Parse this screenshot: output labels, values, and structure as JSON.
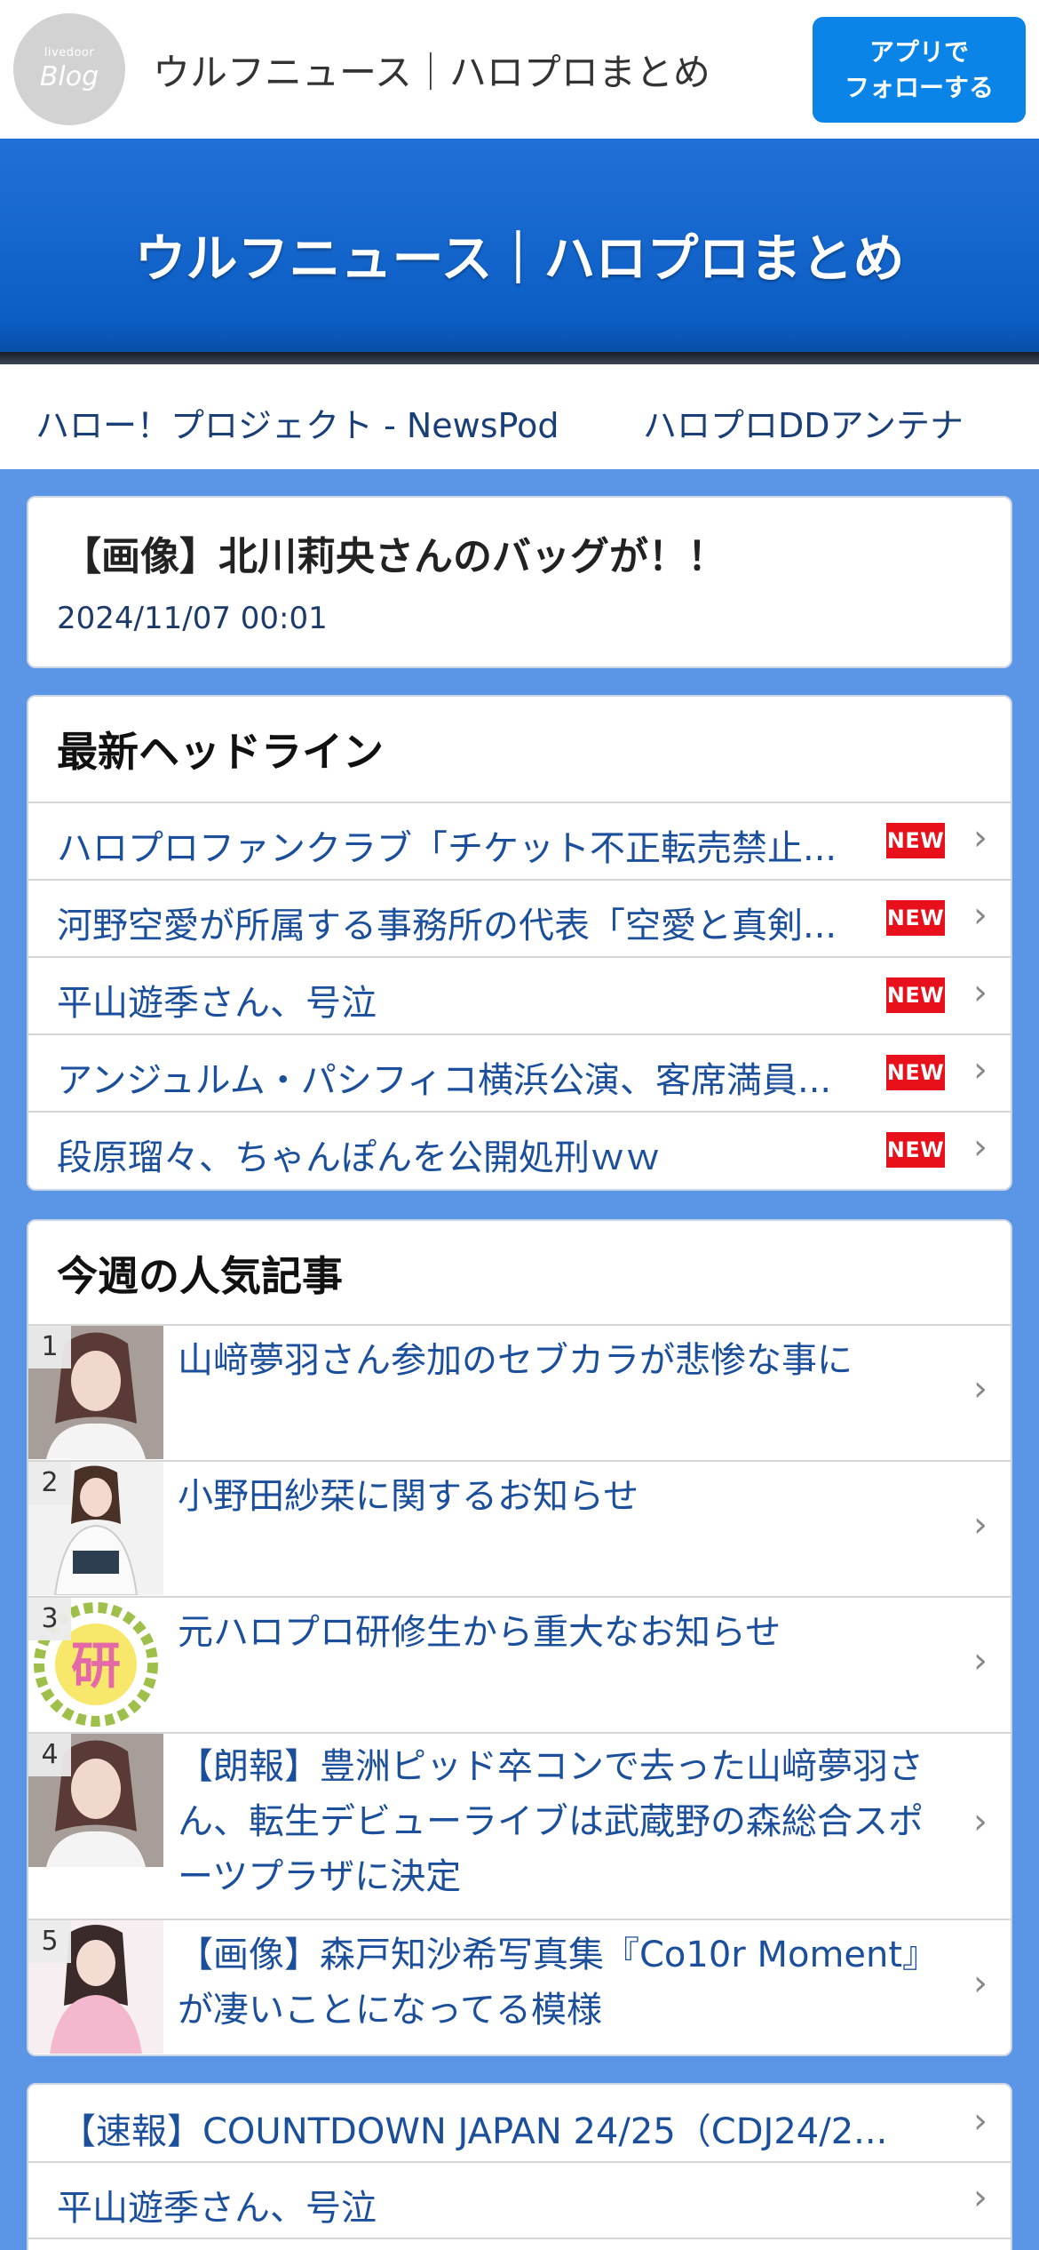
{
  "topbar": {
    "logo_small": "livedoor",
    "logo_big": "Blog",
    "site_name": "ウルフニュース｜ハロプロまとめ",
    "follow_line1": "アプリで",
    "follow_line2": "フォローする"
  },
  "banner": {
    "title": "ウルフニュース｜ハロプロまとめ"
  },
  "links": [
    "ハロー！プロジェクト - NewsPod",
    "ハロプロDDアンテナ"
  ],
  "article": {
    "title": "【画像】北川莉央さんのバッグが！！",
    "date": "2024/11/07 00:01"
  },
  "headlines": {
    "heading": "最新ヘッドライン",
    "badge": "NEW",
    "items": [
      "ハロプロファンクラブ「チケット不正転売禁止...",
      "河野空愛が所属する事務所の代表「空愛と真剣...",
      "平山遊季さん、号泣",
      "アンジュルム・パシフィコ横浜公演、客席満員...",
      "段原瑠々、ちゃんぽんを公開処刑ｗｗ"
    ]
  },
  "popular": {
    "heading": "今週の人気記事",
    "items": [
      {
        "rank": "1",
        "text": "山﨑夢羽さん参加のセブカラが悲惨な事に"
      },
      {
        "rank": "2",
        "text": "小野田紗栞に関するお知らせ"
      },
      {
        "rank": "3",
        "text": "元ハロプロ研修生から重大なお知らせ"
      },
      {
        "rank": "4",
        "text": "【朗報】豊洲ピッド卒コンで去った山﨑夢羽さん、転生デビューライブは武蔵野の森総合スポーツプラザに決定"
      },
      {
        "rank": "5",
        "text": "【画像】森戸知沙希写真集『Co10r Moment』が凄いことになってる模様"
      }
    ]
  },
  "bottom_list": [
    "【速報】COUNTDOWN JAPAN 24/25（CDJ24/2...",
    "平山遊季さん、号泣"
  ],
  "colors": {
    "page_bg": "#5b95e6",
    "banner": "#0b5ec4",
    "follow_button": "#0a84e6",
    "link_text": "#1b4f9c",
    "new_badge": "#e8101b"
  }
}
